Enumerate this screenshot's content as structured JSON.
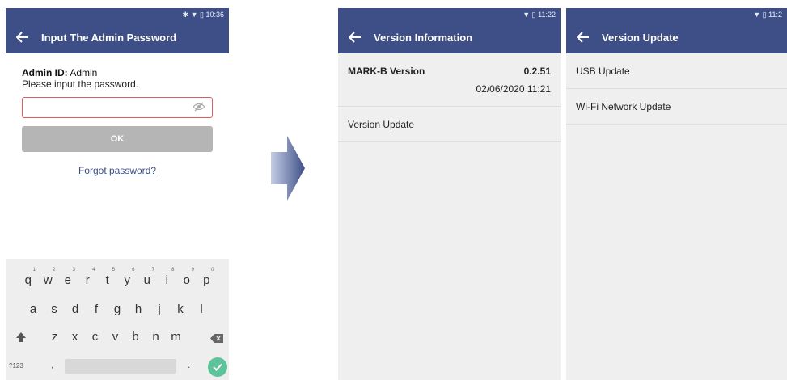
{
  "screen1": {
    "status_time": "10:36",
    "title": "Input The Admin Password",
    "admin_label": "Admin ID:",
    "admin_value": "Admin",
    "instruction": "Please input the password.",
    "ok_label": "OK",
    "forgot_label": "Forgot password?",
    "keyboard": {
      "row1": [
        {
          "k": "q",
          "h": "1"
        },
        {
          "k": "w",
          "h": "2"
        },
        {
          "k": "e",
          "h": "3"
        },
        {
          "k": "r",
          "h": "4"
        },
        {
          "k": "t",
          "h": "5"
        },
        {
          "k": "y",
          "h": "6"
        },
        {
          "k": "u",
          "h": "7"
        },
        {
          "k": "i",
          "h": "8"
        },
        {
          "k": "o",
          "h": "9"
        },
        {
          "k": "p",
          "h": "0"
        }
      ],
      "row2": [
        "a",
        "s",
        "d",
        "f",
        "g",
        "h",
        "j",
        "k",
        "l"
      ],
      "row3": [
        "z",
        "x",
        "c",
        "v",
        "b",
        "n",
        "m"
      ],
      "symbols_label": "?123",
      "comma": ",",
      "period": "."
    }
  },
  "screen2": {
    "status_time": "11:22",
    "title": "Version Information",
    "version_label": "MARK-B Version",
    "version_value": "0.2.51",
    "version_date": "02/06/2020 11:21",
    "update_label": "Version Update"
  },
  "screen3": {
    "status_time": "11:2",
    "title": "Version Update",
    "items": [
      "USB Update",
      "Wi-Fi Network Update"
    ]
  },
  "colors": {
    "appbar": "#3d4f86",
    "error_border": "#e05c5c",
    "ok_disabled": "#b5b5b5",
    "keyboard_done": "#5cc39a"
  }
}
